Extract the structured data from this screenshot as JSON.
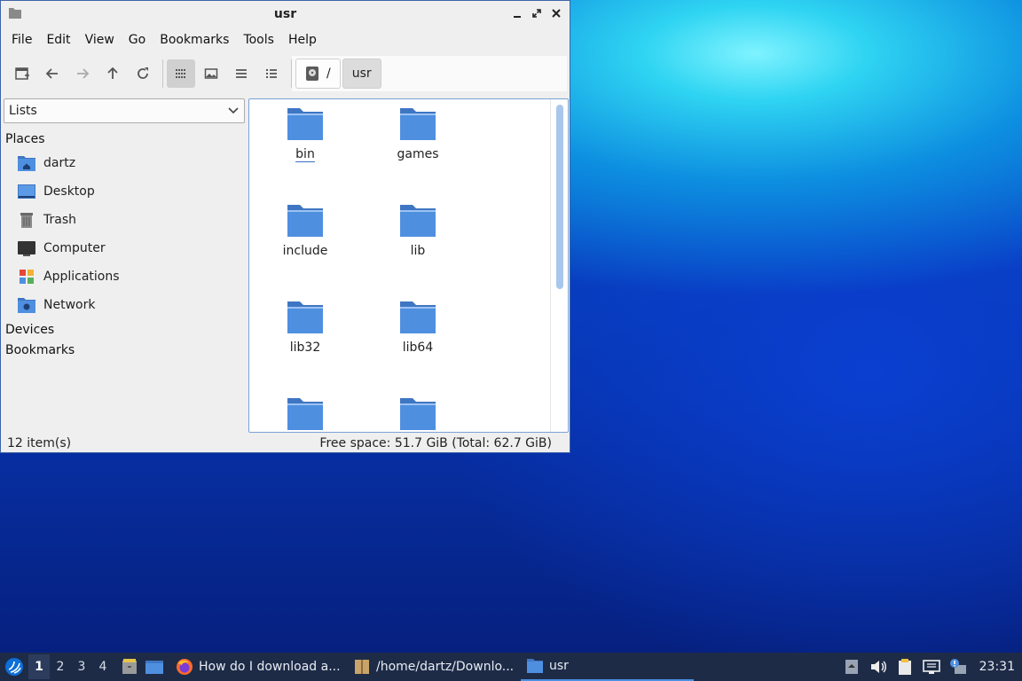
{
  "window": {
    "title": "usr",
    "menu": [
      "File",
      "Edit",
      "View",
      "Go",
      "Bookmarks",
      "Tools",
      "Help"
    ],
    "path": {
      "root": "/",
      "current": "usr"
    },
    "side_panel": {
      "mode": "Lists",
      "places_label": "Places",
      "places": [
        "dartz",
        "Desktop",
        "Trash",
        "Computer",
        "Applications",
        "Network"
      ],
      "devices_label": "Devices",
      "bookmarks_label": "Bookmarks"
    },
    "files": [
      "bin",
      "games",
      "include",
      "lib",
      "lib32",
      "lib64",
      "",
      ""
    ],
    "status": {
      "count": "12 item(s)",
      "free_space": "Free space: 51.7 GiB (Total: 62.7 GiB)"
    }
  },
  "taskbar": {
    "desktops": [
      "1",
      "2",
      "3",
      "4"
    ],
    "tasks": [
      "How do I download a...",
      "/home/dartz/Downlo...",
      "usr"
    ],
    "clock": "23:31"
  },
  "colors": {
    "accent": "#3a6fc8",
    "folder": "#4f8fe0",
    "taskbar": "#1d2b47"
  }
}
